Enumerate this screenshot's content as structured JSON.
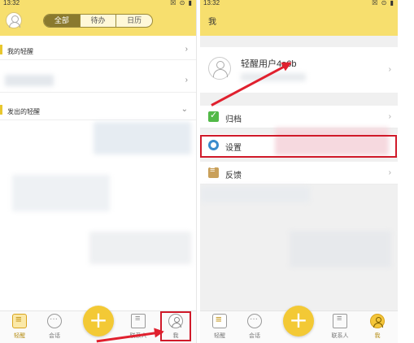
{
  "left_screen": {
    "status_time": "13:32",
    "status_icons": "☒ ⊙ ▮",
    "tabs": [
      {
        "label": "全部",
        "active": true
      },
      {
        "label": "待办",
        "active": false
      },
      {
        "label": "日历",
        "active": false
      }
    ],
    "sections": {
      "my_reminders": "我的轻醒",
      "sent_reminders": "发出的轻醒"
    },
    "tabbar": {
      "remind": "轻醒",
      "chat": "会话",
      "contacts": "联系人",
      "me": "我"
    }
  },
  "right_screen": {
    "status_time": "13:32",
    "status_icons": "☒ ⊙ ▮",
    "title": "我",
    "user_name": "轻醒用户4a6b",
    "menu": {
      "archive": "归档",
      "settings": "设置",
      "feedback": "反馈"
    },
    "tabbar": {
      "remind": "轻醒",
      "chat": "会话",
      "contacts": "联系人",
      "me": "我"
    }
  },
  "colors": {
    "header_yellow": "#f7df6e",
    "accent_yellow": "#f3c935",
    "annotation_red": "#d01a2a"
  },
  "icons": {
    "fab": "+",
    "chevron_right": "›",
    "chevron_down": "⌄"
  }
}
